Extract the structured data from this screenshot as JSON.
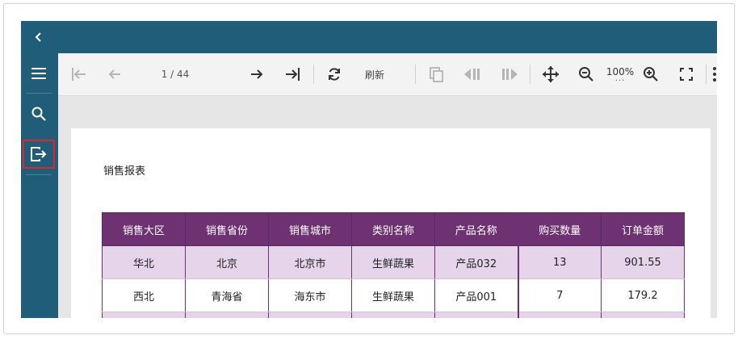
{
  "toolbar": {
    "page_indicator": "1 / 44",
    "refresh_label": "刷新",
    "zoom_level": "100%",
    "zoom_dots": "..."
  },
  "report": {
    "title": "销售报表",
    "columns": [
      "销售大区",
      "销售省份",
      "销售城市",
      "类别名称",
      "产品名称",
      "购买数量",
      "订单金额"
    ],
    "rows": [
      [
        "华北",
        "北京",
        "北京市",
        "生鲜蔬果",
        "产品032",
        "13",
        "901.55"
      ],
      [
        "西北",
        "青海省",
        "海东市",
        "生鲜蔬果",
        "产品001",
        "7",
        "179.2"
      ],
      [
        "",
        "",
        "",
        "",
        "",
        "",
        ""
      ]
    ]
  },
  "icons": {
    "back": "chevron-left-icon",
    "menu": "hamburger-menu-icon",
    "search": "search-icon",
    "export": "export-icon",
    "first": "first-page-icon",
    "prev": "previous-page-icon",
    "next": "next-page-icon",
    "last": "last-page-icon",
    "refresh": "refresh-icon",
    "copy": "copy-icon",
    "prev_section": "previous-section-icon",
    "next_section": "next-section-icon",
    "pan": "pan-move-icon",
    "zoom_out": "zoom-out-icon",
    "zoom_in": "zoom-in-icon",
    "fullscreen": "fullscreen-icon",
    "more": "more-vertical-icon"
  },
  "colors": {
    "brand": "#205d78",
    "header": "#6e3273",
    "row_alt": "#e6d5ea",
    "highlight": "#e0242e"
  }
}
